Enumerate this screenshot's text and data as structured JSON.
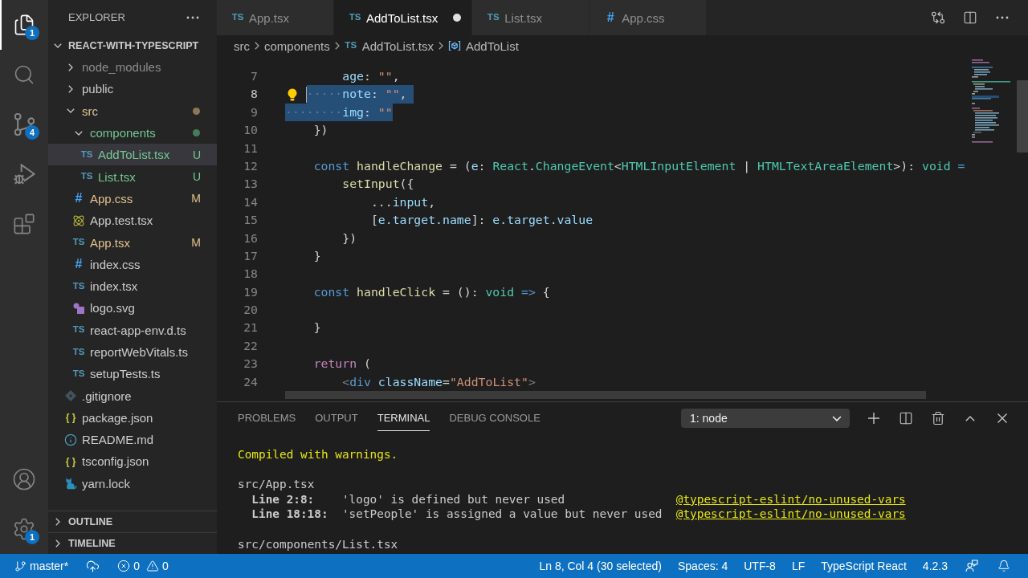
{
  "activity_bar": {
    "top": [
      {
        "kind": "explorer",
        "selected": true,
        "badge": "1"
      },
      {
        "kind": "search",
        "selected": false
      },
      {
        "kind": "source_control",
        "selected": false,
        "badge": "4"
      },
      {
        "kind": "run_debug",
        "selected": false
      },
      {
        "kind": "extensions",
        "selected": false
      }
    ],
    "bottom": [
      {
        "kind": "accounts"
      },
      {
        "kind": "settings",
        "badge": "1"
      }
    ]
  },
  "sidebar": {
    "title": "EXPLORER",
    "section": {
      "title": "REACT-WITH-TYPESCRIPT",
      "expanded": true
    },
    "tree": [
      {
        "kind": "folder",
        "name": "node_modules",
        "expanded": false,
        "dot": false,
        "color": "#8c8c8c",
        "selected": false
      },
      {
        "kind": "folder",
        "name": "public",
        "expanded": false,
        "dot": false,
        "color": "#cccccc",
        "selected": false
      },
      {
        "kind": "folder",
        "name": "src",
        "expanded": true,
        "dot": true,
        "color": "#e2c08d",
        "selected": false,
        "children": [
          {
            "kind": "folder",
            "name": "components",
            "expanded": true,
            "dot": true,
            "color": "#73c991",
            "selected": false,
            "children": [
              {
                "kind": "typescript",
                "glyph": "TS",
                "name": "AddToList.tsx",
                "status": "U",
                "color": "#73c991",
                "selected": true
              },
              {
                "kind": "typescript",
                "glyph": "TS",
                "name": "List.tsx",
                "status": "U",
                "color": "#73c991",
                "selected": false
              }
            ]
          },
          {
            "kind": "css",
            "glyph": "#",
            "name": "App.css",
            "status": "M",
            "color": "#e2c08d",
            "selected": false
          },
          {
            "kind": "react",
            "name": "App.test.tsx",
            "color": "#cccccc",
            "selected": false
          },
          {
            "kind": "typescript",
            "glyph": "TS",
            "name": "App.tsx",
            "status": "M",
            "color": "#e2c08d",
            "selected": false
          },
          {
            "kind": "css",
            "glyph": "#",
            "name": "index.css",
            "color": "#cccccc",
            "selected": false
          },
          {
            "kind": "typescript",
            "glyph": "TS",
            "name": "index.tsx",
            "color": "#cccccc",
            "selected": false
          },
          {
            "kind": "svg",
            "name": "logo.svg",
            "color": "#cccccc",
            "selected": false
          },
          {
            "kind": "typescript",
            "glyph": "TS",
            "name": "react-app-env.d.ts",
            "color": "#cccccc",
            "selected": false
          },
          {
            "kind": "typescript",
            "glyph": "TS",
            "name": "reportWebVitals.ts",
            "color": "#cccccc",
            "selected": false
          },
          {
            "kind": "typescript",
            "glyph": "TS",
            "name": "setupTests.ts",
            "color": "#cccccc",
            "selected": false
          }
        ]
      },
      {
        "kind": "git",
        "name": ".gitignore",
        "color": "#cccccc",
        "selected": false
      },
      {
        "kind": "json",
        "glyph": "{ }",
        "name": "package.json",
        "color": "#cccccc",
        "selected": false
      },
      {
        "kind": "info",
        "name": "README.md",
        "color": "#cccccc",
        "selected": false
      },
      {
        "kind": "json",
        "glyph": "{ }",
        "name": "tsconfig.json",
        "color": "#cccccc",
        "selected": false
      },
      {
        "kind": "yarn",
        "name": "yarn.lock",
        "color": "#cccccc",
        "selected": false
      }
    ],
    "bottom_sections": [
      {
        "title": "OUTLINE",
        "expanded": false
      },
      {
        "title": "TIMELINE",
        "expanded": false
      }
    ]
  },
  "editor": {
    "tabs": [
      {
        "label": "App.tsx",
        "kind": "typescript",
        "glyph": "TS",
        "selected": false,
        "modified": false
      },
      {
        "label": "AddToList.tsx",
        "kind": "typescript",
        "glyph": "TS",
        "selected": true,
        "modified": true
      },
      {
        "label": "List.tsx",
        "kind": "typescript",
        "glyph": "TS",
        "selected": false,
        "modified": false
      },
      {
        "label": "App.css",
        "kind": "css",
        "glyph": "#",
        "selected": false,
        "modified": false
      }
    ],
    "actions": [
      {
        "kind": "compare"
      },
      {
        "kind": "split"
      },
      {
        "kind": "more"
      }
    ],
    "breadcrumbs": [
      {
        "label": "src",
        "kind": "folder"
      },
      {
        "label": "components",
        "kind": "folder"
      },
      {
        "label": "AddToList.tsx",
        "kind": "typescript",
        "glyph": "TS"
      },
      {
        "label": "AddToList",
        "kind": "symbol"
      }
    ],
    "lines": [
      {
        "number": "7",
        "current": false,
        "tokens": [
          {
            "text": "        age",
            "kind": "variable"
          },
          {
            "text": ": ",
            "kind": "plain"
          },
          {
            "text": "\"\"",
            "kind": "string"
          },
          {
            "text": ",",
            "kind": "plain"
          }
        ]
      },
      {
        "number": "8",
        "current": true,
        "selected_tokens": [
          {
            "text": "·····",
            "kind": "whitespace"
          },
          {
            "text": "note",
            "kind": "variable"
          },
          {
            "text": ": ",
            "kind": "plain"
          },
          {
            "text": "\"\"",
            "kind": "string"
          },
          {
            "text": ",",
            "kind": "plain"
          }
        ]
      },
      {
        "number": "9",
        "current": false,
        "selected_tokens": [
          {
            "text": "········",
            "kind": "whitespace"
          },
          {
            "text": "img",
            "kind": "variable"
          },
          {
            "text": ": ",
            "kind": "plain"
          },
          {
            "text": "\"\"",
            "kind": "string"
          }
        ]
      },
      {
        "number": "10",
        "current": false,
        "tokens": [
          {
            "text": "    })",
            "kind": "plain"
          }
        ]
      },
      {
        "number": "11",
        "current": false
      },
      {
        "number": "12",
        "current": false,
        "tokens": [
          {
            "text": "    const ",
            "kind": "storage"
          },
          {
            "text": "handleChange",
            "kind": "function"
          },
          {
            "text": " = (",
            "kind": "plain"
          },
          {
            "text": "e",
            "kind": "variable"
          },
          {
            "text": ": ",
            "kind": "plain"
          },
          {
            "text": "React",
            "kind": "type"
          },
          {
            "text": ".",
            "kind": "plain"
          },
          {
            "text": "ChangeEvent",
            "kind": "type"
          },
          {
            "text": "<",
            "kind": "plain"
          },
          {
            "text": "HTMLInputElement",
            "kind": "type"
          },
          {
            "text": " | ",
            "kind": "plain"
          },
          {
            "text": "HTMLTextAreaElement",
            "kind": "type"
          },
          {
            "text": ">): ",
            "kind": "plain"
          },
          {
            "text": "void ",
            "kind": "type"
          },
          {
            "text": "=",
            "kind": "storage"
          }
        ]
      },
      {
        "number": "13",
        "current": false,
        "tokens": [
          {
            "text": "        setInput",
            "kind": "function"
          },
          {
            "text": "({",
            "kind": "plain"
          }
        ]
      },
      {
        "number": "14",
        "current": false,
        "tokens": [
          {
            "text": "            ...",
            "kind": "plain"
          },
          {
            "text": "input",
            "kind": "variable"
          },
          {
            "text": ",",
            "kind": "plain"
          }
        ]
      },
      {
        "number": "15",
        "current": false,
        "tokens": [
          {
            "text": "            [",
            "kind": "plain"
          },
          {
            "text": "e.target.name",
            "kind": "variable"
          },
          {
            "text": "]: ",
            "kind": "plain"
          },
          {
            "text": "e.target.value",
            "kind": "variable"
          }
        ]
      },
      {
        "number": "16",
        "current": false,
        "tokens": [
          {
            "text": "        })",
            "kind": "plain"
          }
        ]
      },
      {
        "number": "17",
        "current": false,
        "tokens": [
          {
            "text": "    }",
            "kind": "plain"
          }
        ]
      },
      {
        "number": "18",
        "current": false
      },
      {
        "number": "19",
        "current": false,
        "tokens": [
          {
            "text": "    const ",
            "kind": "storage"
          },
          {
            "text": "handleClick",
            "kind": "function"
          },
          {
            "text": " = (): ",
            "kind": "plain"
          },
          {
            "text": "void ",
            "kind": "type"
          },
          {
            "text": "=>",
            "kind": "storage"
          },
          {
            "text": " {",
            "kind": "plain"
          }
        ]
      },
      {
        "number": "20",
        "current": false
      },
      {
        "number": "21",
        "current": false,
        "tokens": [
          {
            "text": "    }",
            "kind": "plain"
          }
        ]
      },
      {
        "number": "22",
        "current": false
      },
      {
        "number": "23",
        "current": false,
        "tokens": [
          {
            "text": "    return",
            "kind": "control"
          },
          {
            "text": " (",
            "kind": "plain"
          }
        ]
      },
      {
        "number": "24",
        "current": false,
        "tokens": [
          {
            "text": "        <",
            "kind": "bracket"
          },
          {
            "text": "div ",
            "kind": "tag"
          },
          {
            "text": "className",
            "kind": "attribute"
          },
          {
            "text": "=",
            "kind": "plain"
          },
          {
            "text": "\"AddToList\"",
            "kind": "string"
          },
          {
            "text": ">",
            "kind": "bracket"
          }
        ]
      }
    ]
  },
  "panel": {
    "tabs": [
      {
        "label": "PROBLEMS",
        "selected": false
      },
      {
        "label": "OUTPUT",
        "selected": false
      },
      {
        "label": "TERMINAL",
        "selected": true
      },
      {
        "label": "DEBUG CONSOLE",
        "selected": false
      }
    ],
    "terminal_select": {
      "value": "1: node"
    },
    "actions": [
      {
        "kind": "add"
      },
      {
        "kind": "split"
      },
      {
        "kind": "delete"
      },
      {
        "kind": "maximize"
      },
      {
        "kind": "close"
      }
    ],
    "terminal": {
      "status": "Compiled with warnings.",
      "files": [
        {
          "path": "src/App.tsx",
          "warnings": [
            {
              "location": "Line 2:8:",
              "message": "'logo' is defined but never used",
              "rule": "@typescript-eslint/no-unused-vars"
            },
            {
              "location": "Line 18:18:",
              "message": "'setPeople' is assigned a value but never used",
              "rule": "@typescript-eslint/no-unused-vars"
            }
          ]
        },
        {
          "path": "src/components/List.tsx"
        }
      ]
    }
  },
  "status_bar": {
    "left": [
      {
        "kind": "branch",
        "label": "master*"
      },
      {
        "kind": "sync"
      },
      {
        "kind": "problems",
        "errors": "0",
        "warnings": "0"
      }
    ],
    "right": [
      {
        "kind": "text",
        "label": "Ln 8, Col 4 (30 selected)"
      },
      {
        "kind": "text",
        "label": "Spaces: 4"
      },
      {
        "kind": "text",
        "label": "UTF-8"
      },
      {
        "kind": "text",
        "label": "LF"
      },
      {
        "kind": "text",
        "label": "TypeScript React"
      },
      {
        "kind": "text",
        "label": "4.2.3"
      },
      {
        "kind": "feedback"
      },
      {
        "kind": "notifications"
      }
    ]
  }
}
